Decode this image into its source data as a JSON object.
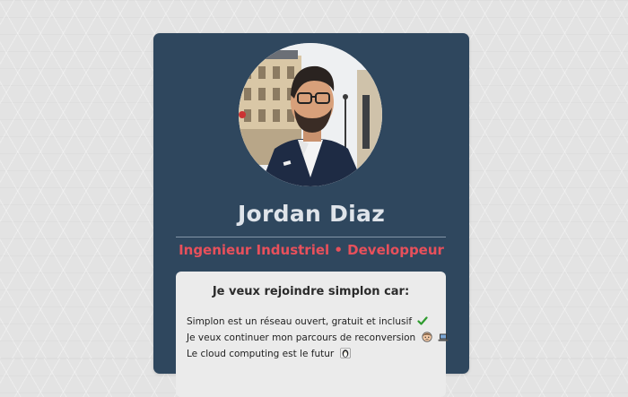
{
  "profile": {
    "name": "Jordan Diaz",
    "subtitle": "Ingenieur Industriel • Developpeur",
    "avatar_icon": "profile-photo"
  },
  "panel": {
    "title": "Je veux rejoindre simplon car:",
    "reasons": [
      {
        "text": "Simplon est un réseau ouvert, gratuit et inclusif",
        "icons": [
          "check-mark-icon"
        ]
      },
      {
        "text": "Je veux continuer mon parcours de reconversion",
        "icons": [
          "technologist-face-icon",
          "laptop-icon"
        ]
      },
      {
        "text": "Le cloud computing est le futur",
        "icons": [
          "penguin-icon"
        ]
      }
    ]
  },
  "colors": {
    "card": "#2f475e",
    "name": "#dfe4ea",
    "accent": "#e8505b",
    "panel": "#ebebeb"
  }
}
